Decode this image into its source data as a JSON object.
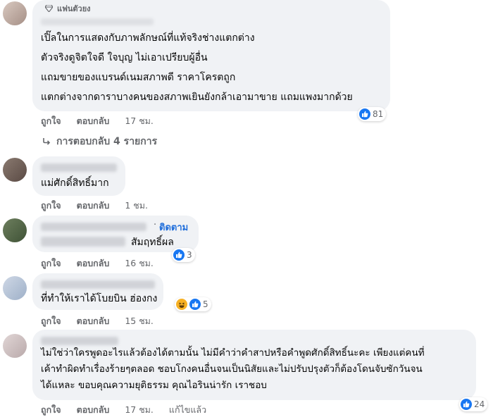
{
  "comments": [
    {
      "badge": "แฟนตัวยง",
      "lines": [
        "เปิ๊ลในการแสดงกับภาพลักษณ์ที่แท้จริงช่างแตกต่าง",
        "ตัวจริงดูจิตใจดี ใจบุญ ไม่เอาเปรียบผู้อื่น",
        "แถมขายของแบรนด์เนมสภาพดี ราคาโครตถูก",
        "แตกต่างจากดาราบางคนของสภาพเยินยังกล้าเอามาขาย แถมแพงมากด้วย"
      ],
      "like_label": "ถูกใจ",
      "reply_label": "ตอบกลับ",
      "time": "17 ชม.",
      "reaction_count": "81",
      "replies_link": "การตอบกลับ 4 รายการ"
    },
    {
      "lines": [
        "แม่ศักดิ์สิทธิ์มาก"
      ],
      "like_label": "ถูกใจ",
      "reply_label": "ตอบกลับ",
      "time": "1 ชม."
    },
    {
      "follow_label": "ติดตาม",
      "lines": [
        "สัมฤทธิ์ผล"
      ],
      "like_label": "ถูกใจ",
      "reply_label": "ตอบกลับ",
      "time": "16 ชม.",
      "reaction_count": "3"
    },
    {
      "lines": [
        "ที่ทำให้เราได้โบยบิน ฮ่องกง"
      ],
      "like_label": "ถูกใจ",
      "reply_label": "ตอบกลับ",
      "time": "15 ชม.",
      "reaction_count": "5"
    },
    {
      "lines": [
        "ไม่ใช่ว่าใครพูดอะไรแล้วต้องได้ตามนั้น ไม่มีคำว่าคำสาปหรือคำพูดศักดิ์สิทธิ์นะคะ เพียงแต่คนที่",
        "เค้าทำผิดทำเรื่องร้ายๆตลอด ชอบโกงคนอื่นจนเป็นนิสัยและไม่ปรับปรุงตัวก็ต้องโดนจับซักวันจน",
        "ได้แหละ ขอบคุณความยุติธรรม คุณไอรินน่ารัก เราชอบ"
      ],
      "like_label": "ถูกใจ",
      "reply_label": "ตอบกลับ",
      "time": "17 ชม.",
      "edited_label": "แก้ไขแล้ว",
      "reaction_count": "24"
    }
  ],
  "colors": {
    "bubble": "#f0f2f5",
    "like_blue": "#1877f2",
    "meta_gray": "#65676b"
  },
  "icons": [
    "diamond-icon",
    "reply-arrow-icon",
    "like-reaction-icon",
    "haha-reaction-icon"
  ]
}
